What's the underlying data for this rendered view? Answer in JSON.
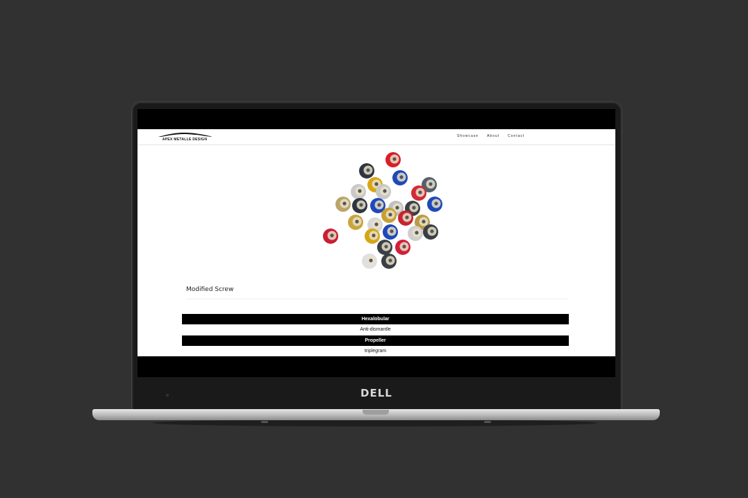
{
  "site": {
    "logo_text": "APEX METALLE DESIGN",
    "nav": [
      "Showcase",
      "About",
      "Contact"
    ]
  },
  "product": {
    "title": "Modified Screw",
    "image_icon": "colorful-screws-image"
  },
  "accordion": [
    {
      "header": "Hexalobular",
      "content": "Anti-dismantle"
    },
    {
      "header": "Propeller",
      "content": "triplegram"
    }
  ],
  "device": {
    "brand": "DELL"
  }
}
